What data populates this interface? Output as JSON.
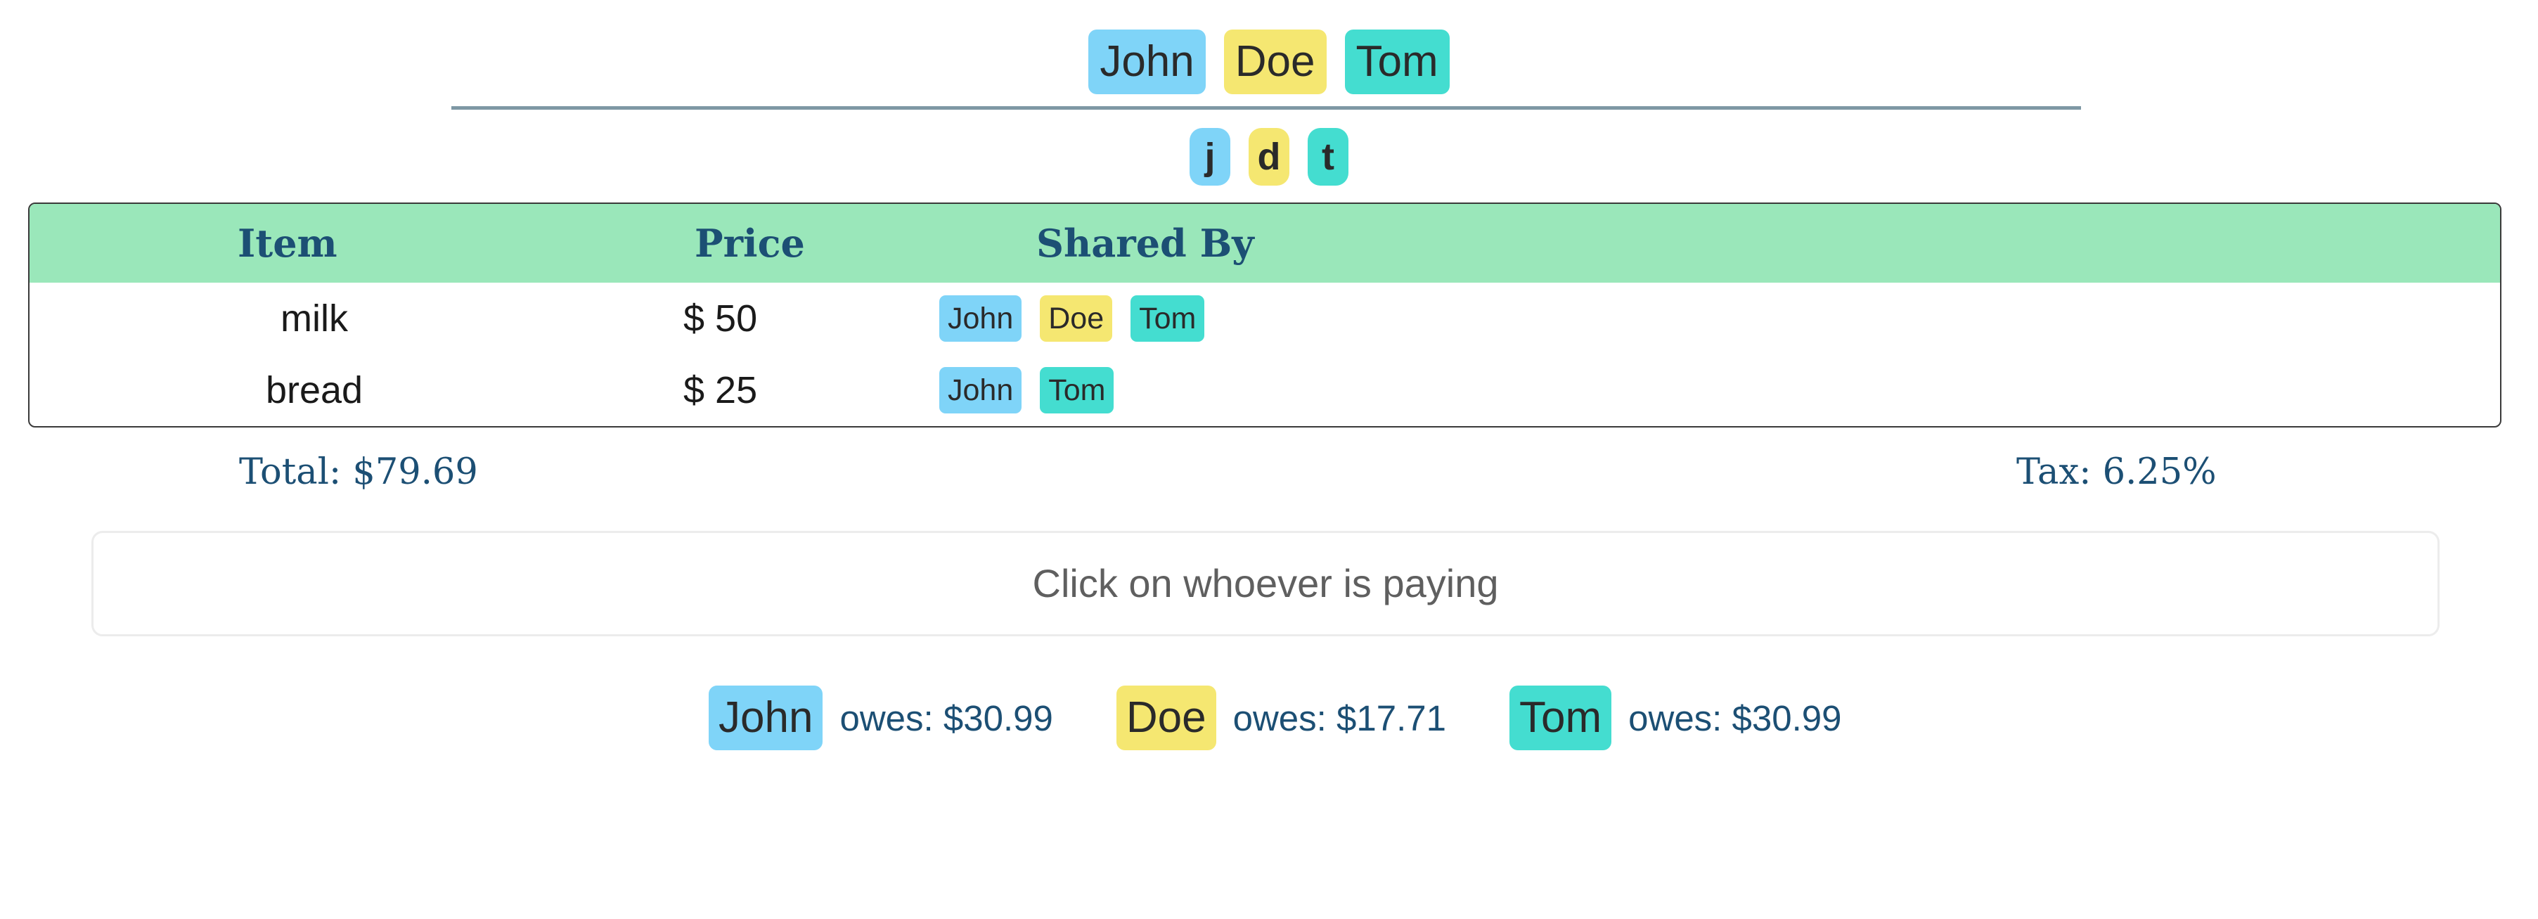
{
  "people": [
    {
      "name": "John",
      "initial": "j",
      "color": "#7fd4f8"
    },
    {
      "name": "Doe",
      "initial": "d",
      "color": "#f5e771"
    },
    {
      "name": "Tom",
      "initial": "t",
      "color": "#44ddd0"
    }
  ],
  "table": {
    "headers": {
      "item": "Item",
      "price": "Price",
      "shared_by": "Shared By"
    },
    "header_color": "#9ae7ba",
    "rows": [
      {
        "item": "milk",
        "price": "$ 50",
        "shared_by": [
          "John",
          "Doe",
          "Tom"
        ]
      },
      {
        "item": "bread",
        "price": "$ 25",
        "shared_by": [
          "John",
          "Tom"
        ]
      }
    ]
  },
  "totals": {
    "total": "Total: $79.69",
    "tax": "Tax: 6.25%"
  },
  "payer_prompt": "Click on whoever is paying",
  "owes": [
    {
      "name": "John",
      "text": "owes: $30.99"
    },
    {
      "name": "Doe",
      "text": "owes: $17.71"
    },
    {
      "name": "Tom",
      "text": "owes: $30.99"
    }
  ]
}
